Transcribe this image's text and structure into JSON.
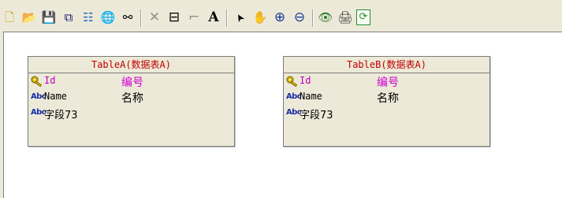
{
  "toolbar": {
    "buttons": [
      {
        "name": "new-document-icon",
        "glyph": "🗋",
        "color": "#c9a200"
      },
      {
        "name": "open-folder-icon",
        "glyph": "📂",
        "color": "#d4a017"
      },
      {
        "name": "save-disk-icon",
        "glyph": "💾",
        "color": "#1a1a70"
      },
      {
        "name": "copy-pages-icon",
        "glyph": "⧉",
        "color": "#1a1a70"
      },
      {
        "name": "hierarchy-tree-icon",
        "glyph": "☷",
        "color": "#2060c0"
      },
      {
        "name": "globe-icon",
        "glyph": "🌐",
        "color": "#1f5fbf"
      },
      {
        "name": "binoculars-icon",
        "glyph": "⚯",
        "color": "#000000"
      },
      {
        "name": "delete-x-icon",
        "glyph": "✕",
        "color": "#909090"
      },
      {
        "name": "table-box-icon",
        "glyph": "⊟",
        "color": "#000000"
      },
      {
        "name": "connector-line-icon",
        "glyph": "⌐",
        "color": "#909090"
      },
      {
        "name": "text-a-icon",
        "glyph": "A",
        "color": "#000000"
      },
      {
        "name": "select-pointer-icon",
        "glyph": "➤",
        "color": "#000000"
      },
      {
        "name": "hand-pan-icon",
        "glyph": "✋",
        "color": "#000000"
      },
      {
        "name": "zoom-in-icon",
        "glyph": "⊕",
        "color": "#1a3a9a"
      },
      {
        "name": "zoom-out-icon",
        "glyph": "⊖",
        "color": "#1a3a9a"
      },
      {
        "name": "eye-view-icon",
        "glyph": "👁",
        "color": "#2a7a2a"
      },
      {
        "name": "print-document-icon",
        "glyph": "🖨",
        "color": "#404040"
      },
      {
        "name": "refresh-icon",
        "glyph": "⟳",
        "color": "#2a8a2a"
      }
    ]
  },
  "tables": [
    {
      "title": "TableA(数据表A)",
      "fields": [
        {
          "type": "key",
          "name": "Id",
          "title": "编号"
        },
        {
          "type": "text",
          "name": "Name",
          "title": "名称"
        },
        {
          "type": "text",
          "name": "字段73",
          "title": ""
        }
      ]
    },
    {
      "title": "TableB(数据表A)",
      "fields": [
        {
          "type": "key",
          "name": "Id",
          "title": "编号"
        },
        {
          "type": "text",
          "name": "Name",
          "title": "名称"
        },
        {
          "type": "text",
          "name": "字段73",
          "title": ""
        }
      ]
    }
  ],
  "labels": {
    "abc_icon_text": "Abc"
  }
}
